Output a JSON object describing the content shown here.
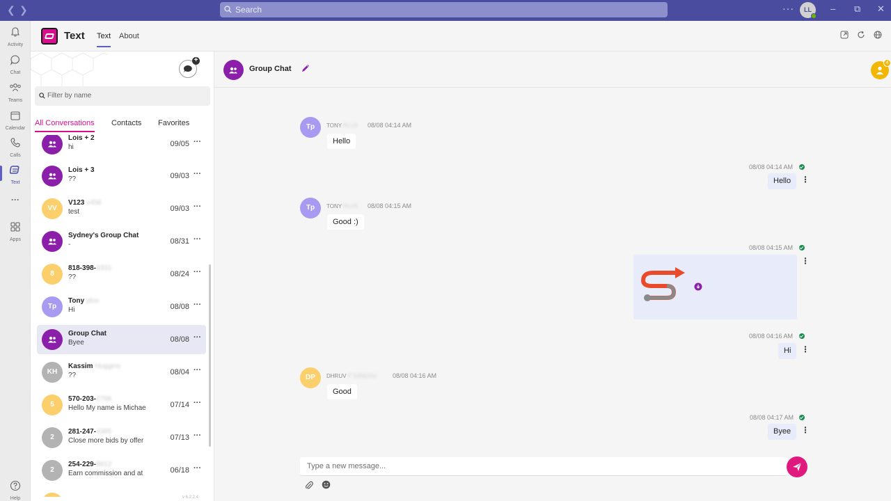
{
  "titlebar": {
    "search_placeholder": "Search",
    "more_label": "···",
    "user_initials": "LL"
  },
  "rail": {
    "items": [
      {
        "label": "Activity",
        "icon": "bell-icon"
      },
      {
        "label": "Chat",
        "icon": "chat-icon"
      },
      {
        "label": "Teams",
        "icon": "teams-icon"
      },
      {
        "label": "Calendar",
        "icon": "calendar-icon"
      },
      {
        "label": "Calls",
        "icon": "phone-icon"
      },
      {
        "label": "Text",
        "icon": "text-app-icon"
      },
      {
        "label": "···",
        "icon": "more-icon"
      },
      {
        "label": "Apps",
        "icon": "apps-icon"
      },
      {
        "label": "Help",
        "icon": "help-icon"
      }
    ]
  },
  "app": {
    "title": "Text",
    "tabs": [
      {
        "label": "Text"
      },
      {
        "label": "About"
      }
    ]
  },
  "conversations": {
    "filter_placeholder": "Filter by name",
    "tabs": [
      {
        "label": "All Conversations"
      },
      {
        "label": "Contacts"
      },
      {
        "label": "Favorites"
      }
    ],
    "items": [
      {
        "initials": "",
        "name": "Lois + 2",
        "name_hidden": "",
        "preview": "hi",
        "date": "09/05",
        "avatar": "group"
      },
      {
        "initials": "",
        "name": "Lois + 3",
        "name_hidden": "",
        "preview": "??",
        "date": "09/03",
        "avatar": "group"
      },
      {
        "initials": "VV",
        "name": "V123",
        "name_hidden": "v456",
        "preview": "test",
        "date": "09/03",
        "avatar": "yellow"
      },
      {
        "initials": "",
        "name": "Sydney's Group Chat",
        "name_hidden": "",
        "preview": "-",
        "date": "08/31",
        "avatar": "group"
      },
      {
        "initials": "8",
        "name": "818-398-",
        "name_hidden": "3331",
        "preview": "??",
        "date": "08/24",
        "avatar": "yellow"
      },
      {
        "initials": "Tp",
        "name": "Tony",
        "name_hidden": "plus",
        "preview": "Hi",
        "date": "08/08",
        "avatar": "purple"
      },
      {
        "initials": "",
        "name": "Group Chat",
        "name_hidden": "",
        "preview": "Byee",
        "date": "08/08",
        "avatar": "group"
      },
      {
        "initials": "KH",
        "name": "Kassim",
        "name_hidden": "Huggins",
        "preview": "??",
        "date": "08/04",
        "avatar": "gray"
      },
      {
        "initials": "5",
        "name": "570-203-",
        "name_hidden": "2766",
        "preview": "Hello My name is Michae",
        "date": "07/14",
        "avatar": "yellow"
      },
      {
        "initials": "2",
        "name": "281-247-",
        "name_hidden": "4385",
        "preview": "Close more bids by offer",
        "date": "07/13",
        "avatar": "gray"
      },
      {
        "initials": "2",
        "name": "254-229-",
        "name_hidden": "8612",
        "preview": "Earn commission and at",
        "date": "06/18",
        "avatar": "gray"
      }
    ],
    "more_label": "···",
    "version": "v 6.2.2.4"
  },
  "chat": {
    "title": "Group Chat",
    "participant_count": "4",
    "messages": [
      {
        "direction": "in",
        "initials": "Tp",
        "sender": "TONY",
        "sender_hidden": "PLUS",
        "time": "08/08 04:14 AM",
        "text": "Hello"
      },
      {
        "direction": "out",
        "time": "08/08 04:14 AM",
        "text": "Hello"
      },
      {
        "direction": "in",
        "initials": "Tp",
        "sender": "TONY",
        "sender_hidden": "PLUS",
        "time": "08/08 04:15 AM",
        "text": "Good :)"
      },
      {
        "direction": "out",
        "time": "08/08 04:15 AM",
        "text": ""
      },
      {
        "direction": "out",
        "time": "08/08 04:16 AM",
        "text": "Hi"
      },
      {
        "direction": "in",
        "initials": "DP",
        "sender": "DHRUV",
        "sender_hidden": "P SANDHU",
        "time": "08/08 04:16 AM",
        "text": "Good"
      },
      {
        "direction": "out",
        "time": "08/08 04:17 AM",
        "text": "Byee"
      }
    ],
    "composer_placeholder": "Type a new message..."
  },
  "colors": {
    "titlebar": "#4a4d9f",
    "accent": "#d6108c",
    "group_avatar": "#8b1fa9",
    "send_button": "#e0197f"
  }
}
